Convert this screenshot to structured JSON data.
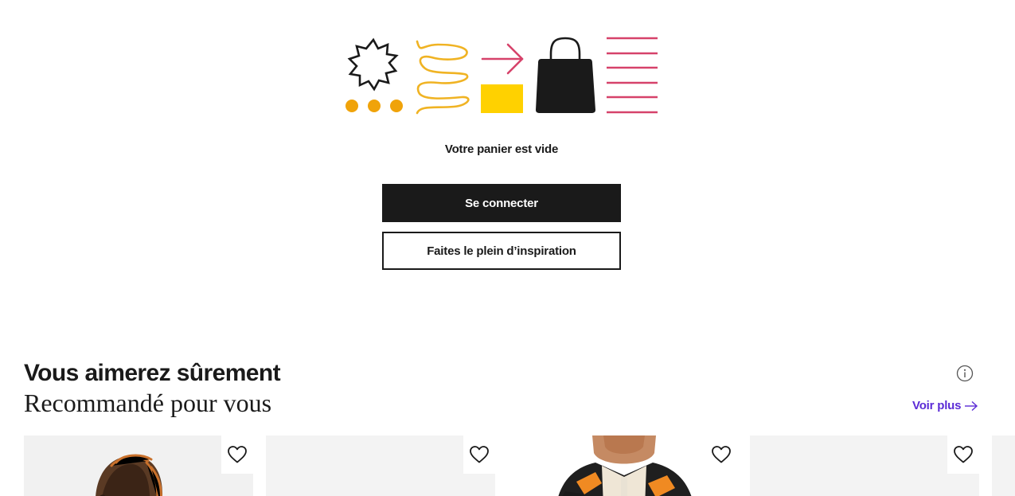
{
  "cart": {
    "empty_message": "Votre panier est vide",
    "login_button": "Se connecter",
    "inspiration_button": "Faites le plein d’inspiration"
  },
  "illustration": {
    "icons": [
      "starburst-icon",
      "dots-icon",
      "spiral-icon",
      "arrow-right-icon",
      "yellow-square-icon",
      "shopping-bag-icon",
      "lines-icon"
    ],
    "colors": {
      "orange": "#f0a30a",
      "yellow": "#ffd100",
      "pink": "#d6426a",
      "black": "#1a1a1a"
    }
  },
  "recommendations": {
    "title": "Vous aimerez sûrement",
    "subtitle": "Recommandé pour vous",
    "see_more": "Voir plus",
    "accent_color": "#5b2bd6",
    "products": [
      {
        "icon": "heart-icon"
      },
      {
        "icon": "heart-icon"
      },
      {
        "icon": "heart-icon"
      },
      {
        "icon": "heart-icon"
      }
    ]
  }
}
